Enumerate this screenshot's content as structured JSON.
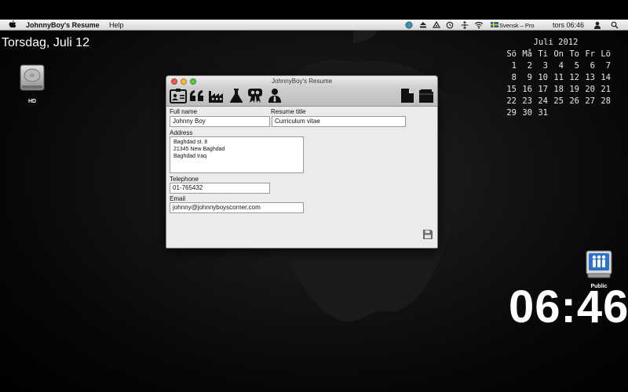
{
  "menubar": {
    "app_name": "JohnnyBoy's Resume",
    "help_label": "Help",
    "input_source": "Svensk – Pro",
    "clock_text": "tors 06:46"
  },
  "desktop": {
    "date_label": "Torsdag, Juli 12",
    "hd_label": "HD",
    "public_label": "Public",
    "big_clock": "06:46"
  },
  "calendar": {
    "title": "Juli 2012",
    "weekdays": [
      "Sö",
      "Må",
      "Ti",
      "On",
      "To",
      "Fr",
      "Lö"
    ],
    "weeks": [
      [
        "1",
        "2",
        "3",
        "4",
        "5",
        "6",
        "7"
      ],
      [
        "8",
        "9",
        "10",
        "11",
        "12",
        "13",
        "14"
      ],
      [
        "15",
        "16",
        "17",
        "18",
        "19",
        "20",
        "21"
      ],
      [
        "22",
        "23",
        "24",
        "25",
        "26",
        "27",
        "28"
      ],
      [
        "29",
        "30",
        "31",
        "",
        "",
        "",
        ""
      ]
    ]
  },
  "window": {
    "title": "JohnnyBoy's Resume",
    "toolbar_icons": [
      "id-card-icon",
      "quote-icon",
      "factory-icon",
      "flask-icon",
      "award-icon",
      "person-icon",
      "new-document-icon",
      "open-folder-icon"
    ],
    "form": {
      "full_name_label": "Full name",
      "full_name_value": "Johnny Boy",
      "resume_title_label": "Resume title",
      "resume_title_value": "Curriculum vitae",
      "address_label": "Address",
      "address_value": "Baghdad st. 8\n21345 New Baghdad\nBaghdad Iraq",
      "telephone_label": "Telephone",
      "telephone_value": "01-765432",
      "email_label": "Email",
      "email_value": "johnny@johnnyboyscorner.com"
    }
  },
  "colors": {
    "close": "#ee5d52",
    "minimize": "#f5bc3c",
    "zoom": "#5fc54c"
  }
}
